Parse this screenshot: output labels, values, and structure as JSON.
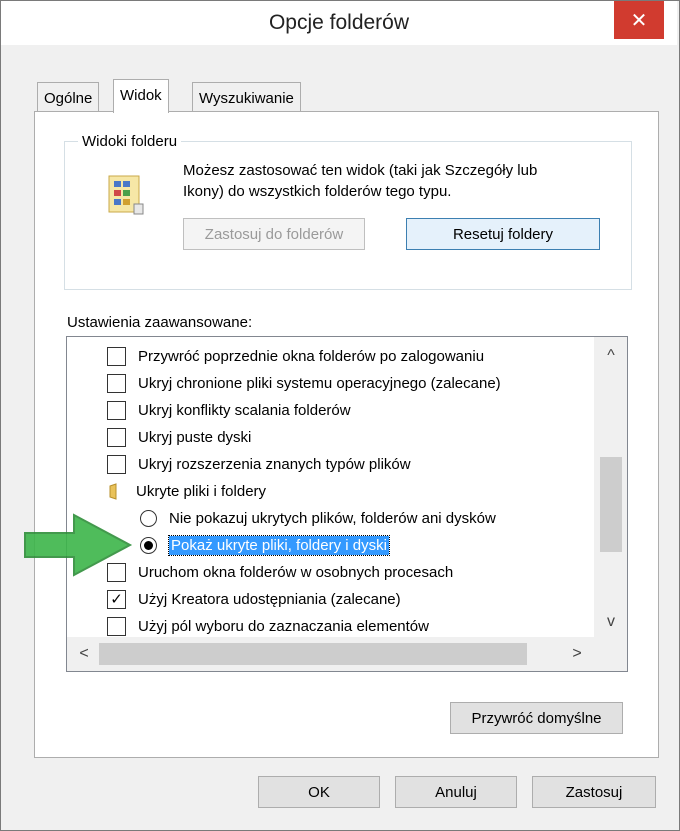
{
  "window": {
    "title": "Opcje folderów",
    "close_glyph": "✕"
  },
  "tabs": [
    {
      "label": "Ogólne",
      "active": false
    },
    {
      "label": "Widok",
      "active": true
    },
    {
      "label": "Wyszukiwanie",
      "active": false
    }
  ],
  "folder_views": {
    "legend": "Widoki folderu",
    "description_line1": "Możesz zastosować ten widok (taki jak Szczegóły lub",
    "description_line2": "Ikony) do wszystkich folderów tego typu.",
    "apply_button": "Zastosuj do folderów",
    "reset_button": "Resetuj foldery"
  },
  "advanced": {
    "label": "Ustawienia zaawansowane:",
    "items": [
      {
        "type": "checkbox",
        "checked": false,
        "label": "Przywróć poprzednie okna folderów po zalogowaniu"
      },
      {
        "type": "checkbox",
        "checked": false,
        "label": "Ukryj chronione pliki systemu operacyjnego (zalecane)"
      },
      {
        "type": "checkbox",
        "checked": false,
        "label": "Ukryj konflikty scalania folderów"
      },
      {
        "type": "checkbox",
        "checked": false,
        "label": "Ukryj puste dyski"
      },
      {
        "type": "checkbox",
        "checked": false,
        "label": "Ukryj rozszerzenia znanych typów plików"
      },
      {
        "type": "folder",
        "label": "Ukryte pliki i foldery"
      },
      {
        "type": "radio",
        "checked": false,
        "label": "Nie pokazuj ukrytych plików, folderów ani dysków"
      },
      {
        "type": "radio",
        "checked": true,
        "label": "Pokaż ukryte pliki, foldery i dyski"
      },
      {
        "type": "checkbox",
        "checked": false,
        "label": "Uruchom okna folderów w osobnych procesach"
      },
      {
        "type": "checkbox",
        "checked": true,
        "label": "Użyj Kreatora udostępniania (zalecane)"
      },
      {
        "type": "checkbox",
        "checked": false,
        "label": "Użyj pól wyboru do zaznaczania elementów"
      }
    ],
    "check_glyph": "✓"
  },
  "scroll": {
    "up": "^",
    "down": "v",
    "left": "<",
    "right": ">"
  },
  "restore_defaults": "Przywróć domyślne",
  "footer": {
    "ok": "OK",
    "cancel": "Anuluj",
    "apply": "Zastosuj"
  },
  "colors": {
    "close_button": "#d13b2f",
    "selection": "#3399ff",
    "arrow": "#3cb54a"
  }
}
